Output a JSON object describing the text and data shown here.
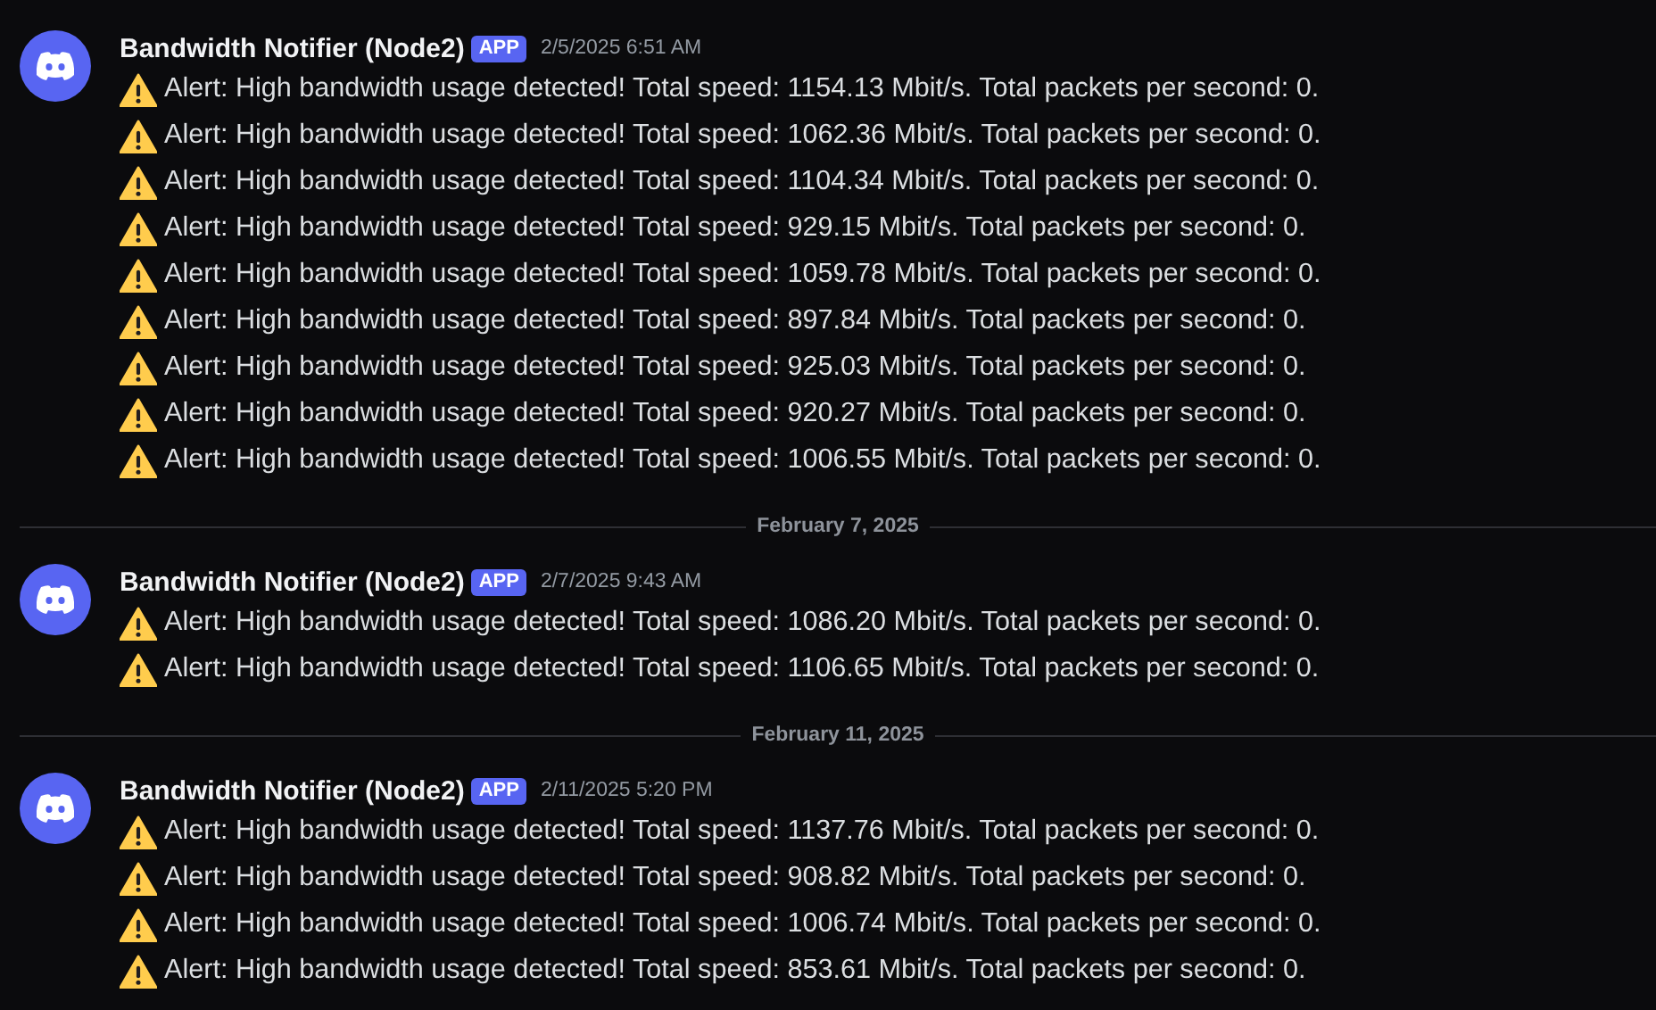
{
  "groups": [
    {
      "author": "Bandwidth Notifier (Node2)",
      "badge": "APP",
      "timestamp": "2/5/2025 6:51 AM",
      "messages": [
        "Alert: High bandwidth usage detected! Total speed: 1154.13 Mbit/s. Total packets per second: 0.",
        "Alert: High bandwidth usage detected! Total speed: 1062.36 Mbit/s. Total packets per second: 0.",
        "Alert: High bandwidth usage detected! Total speed: 1104.34 Mbit/s. Total packets per second: 0.",
        "Alert: High bandwidth usage detected! Total speed: 929.15 Mbit/s. Total packets per second: 0.",
        "Alert: High bandwidth usage detected! Total speed: 1059.78 Mbit/s. Total packets per second: 0.",
        "Alert: High bandwidth usage detected! Total speed: 897.84 Mbit/s. Total packets per second: 0.",
        "Alert: High bandwidth usage detected! Total speed: 925.03 Mbit/s. Total packets per second: 0.",
        "Alert: High bandwidth usage detected! Total speed: 920.27 Mbit/s. Total packets per second: 0.",
        "Alert: High bandwidth usage detected! Total speed: 1006.55 Mbit/s. Total packets per second: 0."
      ]
    },
    {
      "divider": "February 7, 2025",
      "author": "Bandwidth Notifier (Node2)",
      "badge": "APP",
      "timestamp": "2/7/2025 9:43 AM",
      "messages": [
        "Alert: High bandwidth usage detected! Total speed: 1086.20 Mbit/s. Total packets per second: 0.",
        "Alert: High bandwidth usage detected! Total speed: 1106.65 Mbit/s. Total packets per second: 0."
      ]
    },
    {
      "divider": "February 11, 2025",
      "author": "Bandwidth Notifier (Node2)",
      "badge": "APP",
      "timestamp": "2/11/2025 5:20 PM",
      "messages": [
        "Alert: High bandwidth usage detected! Total speed: 1137.76 Mbit/s. Total packets per second: 0.",
        "Alert: High bandwidth usage detected! Total speed: 908.82 Mbit/s. Total packets per second: 0.",
        "Alert: High bandwidth usage detected! Total speed: 1006.74 Mbit/s. Total packets per second: 0.",
        "Alert: High bandwidth usage detected! Total speed: 853.61 Mbit/s. Total packets per second: 0."
      ]
    }
  ]
}
